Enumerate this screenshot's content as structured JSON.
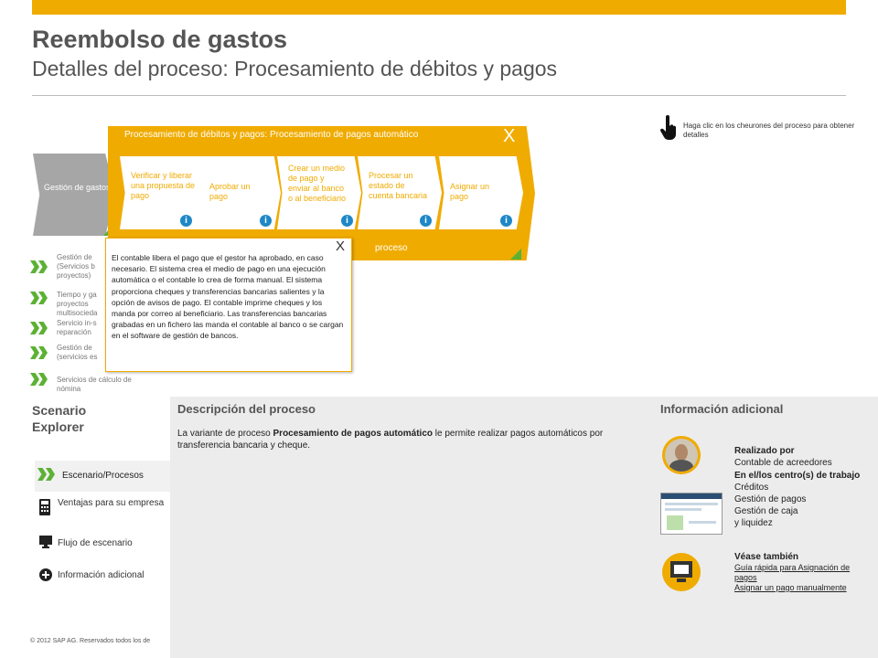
{
  "header": {
    "title": "Reembolso de gastos",
    "subtitle": "Detalles del proceso: Procesamiento de débitos y pagos"
  },
  "hint": "Haga clic en los cheurones del proceso para obtener detalles",
  "process_panel": {
    "title": "Procesamiento de débitos y pagos: Procesamiento de pagos automático",
    "close_label": "X",
    "bottom_label": "proceso",
    "parent_chevron": "Gestión de gastos",
    "steps": [
      {
        "label": "Verificar y liberar una propuesta de pago",
        "info": "i"
      },
      {
        "label": "Aprobar un pago",
        "info": "i"
      },
      {
        "label": "Crear un medio de pago y enviar al banco o al beneficiario",
        "info": "i"
      },
      {
        "label": "Procesar un estado de cuenta bancaria",
        "info": "i"
      },
      {
        "label": "Asignar un pago",
        "info": "i"
      }
    ]
  },
  "scenario_list": [
    "Gestión de (Servicios b proyectos)",
    "Tiempo y ga proyectos multisocieda",
    "Servicio in-s reparación",
    "Gestión de (servicios es",
    "Servicios de cálculo de nómina"
  ],
  "popup": {
    "close_label": "X",
    "text": "El contable libera el pago que el gestor ha aprobado, en caso necesario. El sistema crea el medio de pago en una ejecución automática o el contable lo crea de forma manual. El sistema proporciona cheques y transferencias bancarias salientes y la opción de avisos de pago. El contable imprime cheques y los manda por correo al beneficiario. Las transferencias bancarias grabadas en un fichero las manda el contable al banco o se cargan en el software de gestión de bancos."
  },
  "scenario_explorer": {
    "title_line1": "Scenario",
    "title_line2": "Explorer",
    "menu": [
      {
        "label": "Escenario/Procesos",
        "icon": "double-chevron-icon"
      },
      {
        "label": "Ventajas para su empresa",
        "icon": "calculator-icon"
      },
      {
        "label": "Flujo de escenario",
        "icon": "monitor-icon"
      },
      {
        "label": "Información adicional",
        "icon": "plus-circle-icon"
      }
    ]
  },
  "description": {
    "heading": "Descripción del proceso",
    "text_before": "La variante de proceso ",
    "text_bold": "Procesamiento de pagos automático",
    "text_after": " le permite realizar pagos automáticos por transferencia bancaria y cheque."
  },
  "additional": {
    "heading": "Información adicional",
    "performed_by_label": "Realizado por",
    "performed_by_value": "Contable de acreedores",
    "centers_label": "En el/los centro(s) de trabajo",
    "centers": [
      "Créditos",
      "Gestión de pagos",
      "Gestión de caja y liquidez"
    ],
    "see_also_label": "Véase también",
    "links": [
      "Guía rápida para Asignación de pagos",
      "Asignar un pago manualmente"
    ]
  },
  "footer": "© 2012 SAP AG. Reservados todos los de",
  "colors": {
    "accent": "#f0ab00",
    "green": "#5cb135",
    "info_blue": "#1e88c7",
    "gray_chevron": "#a6a6a6"
  }
}
